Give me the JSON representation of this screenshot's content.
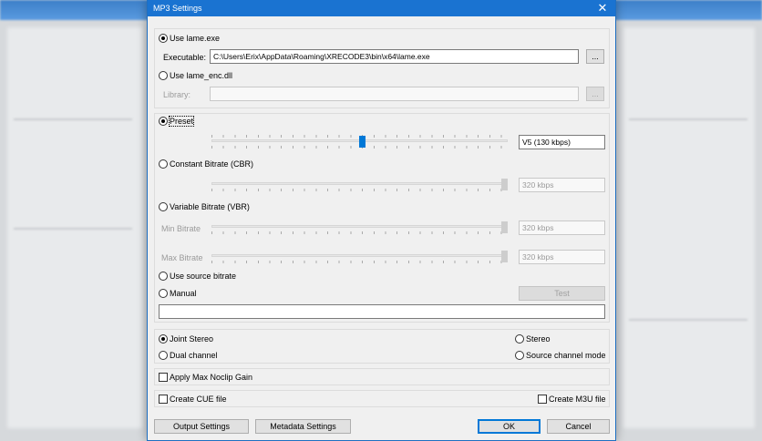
{
  "dialog": {
    "title": "MP3 Settings",
    "close_glyph": "✕"
  },
  "encoder": {
    "use_lame_exe_label": "Use lame.exe",
    "executable_label": "Executable:",
    "executable_value": "C:\\Users\\Erix\\AppData\\Roaming\\XRECODE3\\bin\\x64\\lame.exe",
    "browse_label": "...",
    "use_lame_enc_label": "Use lame_enc.dll",
    "library_label": "Library:",
    "library_value": "",
    "library_browse_label": "..."
  },
  "bitrate": {
    "preset_label": "Preset",
    "preset_value": "V5 (130 kbps)",
    "preset_level": 0.51,
    "cbr_label": "Constant Bitrate (CBR)",
    "cbr_value": "320 kbps",
    "vbr_label": "Variable Bitrate (VBR)",
    "min_bitrate_label": "Min Bitrate",
    "min_bitrate_value": "320 kbps",
    "max_bitrate_label": "Max Bitrate",
    "max_bitrate_value": "320 kbps",
    "source_bitrate_label": "Use source bitrate",
    "manual_label": "Manual",
    "test_label": "Test",
    "manual_value": ""
  },
  "channels": {
    "joint_stereo_label": "Joint Stereo",
    "stereo_label": "Stereo",
    "dual_channel_label": "Dual channel",
    "source_channel_label": "Source channel mode"
  },
  "options": {
    "noclip_label": "Apply Max Noclip Gain",
    "cue_label": "Create CUE file",
    "m3u_label": "Create M3U file"
  },
  "footer": {
    "output_settings_label": "Output Settings",
    "metadata_settings_label": "Metadata Settings",
    "ok_label": "OK",
    "cancel_label": "Cancel"
  }
}
